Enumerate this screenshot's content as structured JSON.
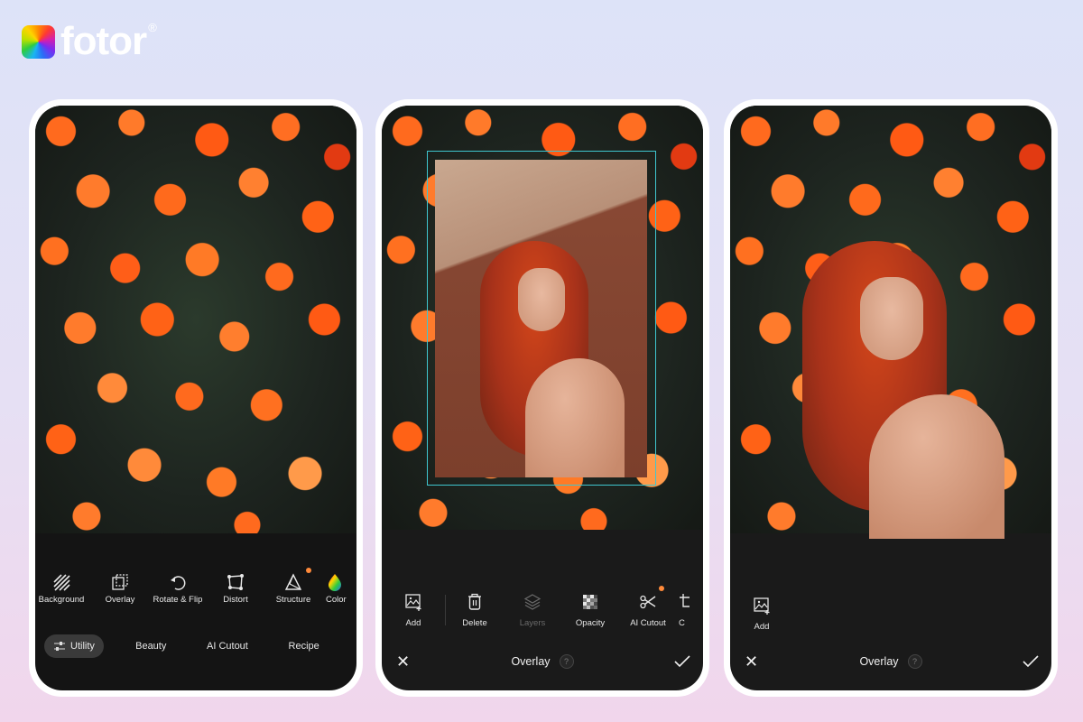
{
  "brand": {
    "name": "fotor",
    "registered": "®"
  },
  "colors": {
    "accent_dot": "#ff8a3a",
    "selection": "#3fc6cf",
    "toolbar_bg": "#141414"
  },
  "phone1": {
    "tools": [
      {
        "label": "Background",
        "icon": "background-hatch-icon",
        "badge": false
      },
      {
        "label": "Overlay",
        "icon": "overlay-icon",
        "badge": false
      },
      {
        "label": "Rotate & Flip",
        "icon": "rotate-icon",
        "badge": false
      },
      {
        "label": "Distort",
        "icon": "distort-icon",
        "badge": false
      },
      {
        "label": "Structure",
        "icon": "structure-icon",
        "badge": true
      },
      {
        "label": "Color",
        "icon": "color-icon",
        "badge": false
      }
    ],
    "categories": [
      {
        "label": "Utility",
        "active": true
      },
      {
        "label": "Beauty",
        "active": false
      },
      {
        "label": "AI Cutout",
        "active": false
      },
      {
        "label": "Recipe",
        "active": false
      }
    ]
  },
  "phone2": {
    "tools": [
      {
        "label": "Add",
        "icon": "add-image-icon",
        "disabled": false
      },
      {
        "label": "Delete",
        "icon": "trash-icon",
        "disabled": false
      },
      {
        "label": "Layers",
        "icon": "layers-icon",
        "disabled": true
      },
      {
        "label": "Opacity",
        "icon": "opacity-icon",
        "disabled": false
      },
      {
        "label": "AI Cutout",
        "icon": "scissors-icon",
        "disabled": false,
        "badge": true
      },
      {
        "label": "C",
        "icon": "crop-icon",
        "disabled": false
      }
    ],
    "bottom_bar": {
      "title": "Overlay",
      "help": "?"
    }
  },
  "phone3": {
    "tools": [
      {
        "label": "Add",
        "icon": "add-image-icon"
      }
    ],
    "bottom_bar": {
      "title": "Overlay",
      "help": "?"
    }
  }
}
